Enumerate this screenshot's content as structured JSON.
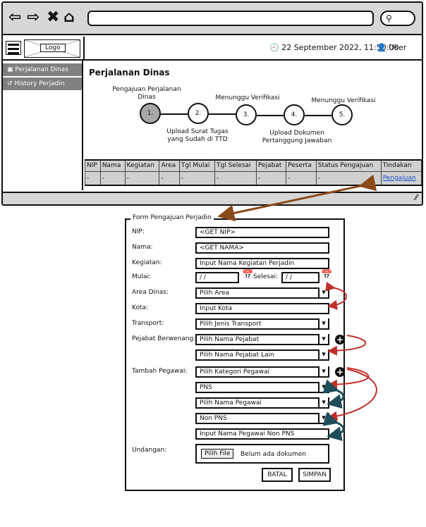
{
  "browser": {
    "nav_icons": [
      "back-icon",
      "forward-icon",
      "close-icon",
      "home-icon"
    ],
    "search_icon": "search-icon"
  },
  "header": {
    "logo": "Logo",
    "datetime": "22 September 2022, 11:50:00",
    "user": "User"
  },
  "sidebar": {
    "items": [
      {
        "label": "Perjalanan Dinas",
        "icon": "briefcase-icon"
      },
      {
        "label": "History Perjadin",
        "icon": "history-icon"
      }
    ]
  },
  "main": {
    "title": "Perjalanan Dinas",
    "steps": [
      {
        "number": "1.",
        "label": "Pengajuan Perjalanan Dinas"
      },
      {
        "number": "2.",
        "label": "Upload Surat Tugas yang Sudah di TTD"
      },
      {
        "number": "3.",
        "label": "Menunggu Verifikasi"
      },
      {
        "number": "4.",
        "label": "Upload Dokumen Pertanggung Jawaban"
      },
      {
        "number": "5.",
        "label": "Menunggu Verifikasi"
      }
    ],
    "table": {
      "headers": [
        "NIP",
        "Nama",
        "Kegiatan",
        "Area",
        "Tgl Mulai",
        "Tgl Selesai",
        "Pejabat",
        "Peserta",
        "Status Pengajuan",
        "Tindakan"
      ],
      "row": [
        "-",
        "-",
        "-",
        "-",
        "-",
        "-",
        "-",
        "-",
        "-"
      ],
      "action": "Pengajuan"
    }
  },
  "form": {
    "title": "Form Pengajuan Perjadin",
    "nip_label": "NIP:",
    "nip_value": "<GET NIP>",
    "nama_label": "Nama:",
    "nama_value": "<GET NAMA>",
    "kegiatan_label": "Kegiatan:",
    "kegiatan_placeholder": "Input Nama Kegiatan Perjadin",
    "mulai_label": "Mulai:",
    "mulai_value": "/ /",
    "selesai_label": "Selesai:",
    "selesai_value": "/ /",
    "area_label": "Area Dinas:",
    "area_select": "Pilih Area",
    "kota_label": "Kota:",
    "kota_placeholder": "Input Kota",
    "transport_label": "Transport:",
    "transport_select": "Pilih Jenis Transport",
    "pejabat_label": "Pejabat Berwenang:",
    "pejabat_select": "Pilih Nama Pejabat",
    "pejabat_lain_select": "Pilih Nama Pejabat Lain",
    "pegawai_label": "Tambah Pegawai:",
    "kategori_select": "Pilih Kategori Pegawai",
    "pns_select": "PNS",
    "pegawai_select": "Pilih Nama Pegawai",
    "non_pns_select": "Non PNS",
    "non_pns_input": "Input Nama Pegawai Non PNS",
    "undangan_label": "Undangan:",
    "file_button": "Pilih File",
    "file_status": "Belum ada dokumen",
    "batal": "BATAL",
    "simpan": "SIMPAN"
  }
}
